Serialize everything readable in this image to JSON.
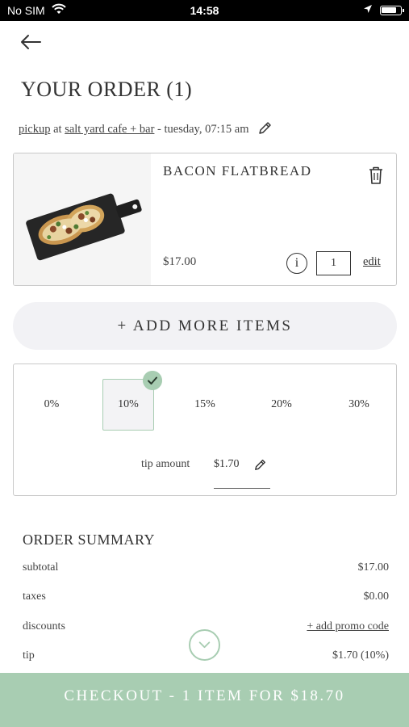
{
  "status_bar": {
    "carrier": "No SIM",
    "time": "14:58"
  },
  "page": {
    "title": "YOUR ORDER (1)"
  },
  "order_info": {
    "mode": "pickup",
    "at": "at",
    "venue": "salt yard cafe + bar",
    "time": "- tuesday, 07:15 am"
  },
  "cart_item": {
    "name": "BACON FLATBREAD",
    "price": "$17.00",
    "info_label": "i",
    "quantity": "1",
    "edit_label": "edit"
  },
  "add_more_label": "+ ADD MORE ITEMS",
  "tip": {
    "options": [
      "0%",
      "10%",
      "15%",
      "20%",
      "30%"
    ],
    "selected": "10%",
    "amount_label": "tip amount",
    "amount_value": "$1.70"
  },
  "summary": {
    "title": "ORDER SUMMARY",
    "rows": [
      {
        "label": "subtotal",
        "value": "$17.00"
      },
      {
        "label": "taxes",
        "value": "$0.00"
      },
      {
        "label": "discounts",
        "value": "+ add promo code"
      },
      {
        "label": "tip",
        "value": "$1.70 (10%)"
      }
    ]
  },
  "checkout_label": "CHECKOUT - 1 ITEM FOR $18.70",
  "colors": {
    "accent": "#a8cdb2",
    "text": "#333333",
    "pill": "#f2f2f5"
  }
}
